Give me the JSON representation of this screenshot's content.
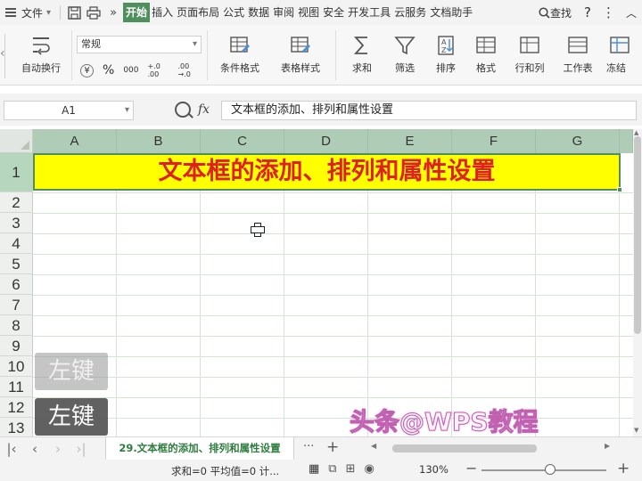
{
  "menubar": {
    "file_label": "文件",
    "tabs": [
      "开始",
      "插入",
      "页面布局",
      "公式",
      "数据",
      "审阅",
      "视图",
      "安全",
      "开发工具",
      "云服务",
      "文档助手"
    ],
    "active_tab": "开始",
    "search_label": "查找",
    "overflow_glyph": "»"
  },
  "ribbon": {
    "wrap_text": "自动换行",
    "number_format": "常规",
    "currency": "¥",
    "percent": "%",
    "thousands": "000",
    "inc_decimal": "+.0 .00",
    "dec_decimal": ".00 →.0",
    "conditional_format": "条件格式",
    "table_style": "表格样式",
    "sum": "求和",
    "filter": "筛选",
    "sort": "排序",
    "format": "格式",
    "rows_cols": "行和列",
    "worksheet": "工作表",
    "freeze": "冻结"
  },
  "formula_bar": {
    "name_box": "A1",
    "fx": "fx",
    "content": "文本框的添加、排列和属性设置"
  },
  "grid": {
    "columns": [
      "A",
      "B",
      "C",
      "D",
      "E",
      "F",
      "G"
    ],
    "rows": [
      "1",
      "2",
      "3",
      "4",
      "5",
      "6",
      "7",
      "8",
      "9",
      "10",
      "11",
      "12",
      "13"
    ],
    "merged_title": "文本框的添加、排列和属性设置",
    "title_fill": "#ffff00",
    "title_color": "#e02020"
  },
  "overlays": {
    "key_faded": "左键",
    "key_solid": "左键",
    "watermark": "头条@WPS教程"
  },
  "sheetbar": {
    "sheet_name": "29.文本框的添加、排列和属性设置",
    "more": "···",
    "add": "+"
  },
  "statusbar": {
    "stats": "求和=0  平均值=0  计...",
    "zoom": "130%",
    "zoom_level": 0.55
  },
  "colors": {
    "accent": "#4f8e5d",
    "header": "#afcdb6"
  }
}
